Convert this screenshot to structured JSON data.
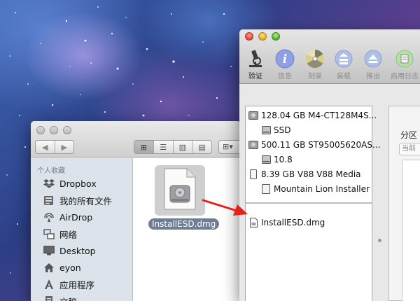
{
  "finder": {
    "sidebar_header": "个人收藏",
    "items": [
      {
        "label": "Dropbox",
        "icon": "dropbox-icon"
      },
      {
        "label": "我的所有文件",
        "icon": "all-files-icon"
      },
      {
        "label": "AirDrop",
        "icon": "airdrop-icon"
      },
      {
        "label": "网络",
        "icon": "network-icon"
      },
      {
        "label": "Desktop",
        "icon": "desktop-icon"
      },
      {
        "label": "eyon",
        "icon": "home-icon"
      },
      {
        "label": "应用程序",
        "icon": "applications-icon"
      },
      {
        "label": "文稿",
        "icon": "documents-icon"
      }
    ],
    "file": {
      "name": "InstallESD.dmg",
      "icon": "dmg-disk-image-icon"
    }
  },
  "disk_utility": {
    "toolbar": [
      {
        "label": "验证",
        "icon": "microscope-icon",
        "enabled": true
      },
      {
        "label": "信息",
        "icon": "info-icon",
        "enabled": false
      },
      {
        "label": "刻录",
        "icon": "burn-icon",
        "enabled": false
      },
      {
        "label": "装载",
        "icon": "mount-icon",
        "enabled": false
      },
      {
        "label": "推出",
        "icon": "eject-icon",
        "enabled": false
      },
      {
        "label": "启用日志",
        "icon": "enable-journaling-icon",
        "enabled": false
      }
    ],
    "disks": [
      {
        "label": "128.04 GB M4-CT128M4S...",
        "icon": "hard-disk-icon"
      },
      {
        "label": "SSD",
        "icon": "volume-icon"
      },
      {
        "label": "500.11 GB ST95005620AS...",
        "icon": "hard-disk-icon"
      },
      {
        "label": "10.8",
        "icon": "volume-icon"
      },
      {
        "label": "8.39 GB V88 V88 Media",
        "icon": "usb-media-icon"
      },
      {
        "label": "Mountain Lion Installer",
        "icon": "volume-icon"
      }
    ],
    "images": [
      {
        "label": "InstallESD.dmg",
        "icon": "disk-image-file-icon"
      }
    ],
    "right_pane": {
      "tab": "分区",
      "sub": "当前"
    }
  },
  "colors": {
    "arrow": "#e8201c",
    "selection_label": "#6f7d92"
  }
}
